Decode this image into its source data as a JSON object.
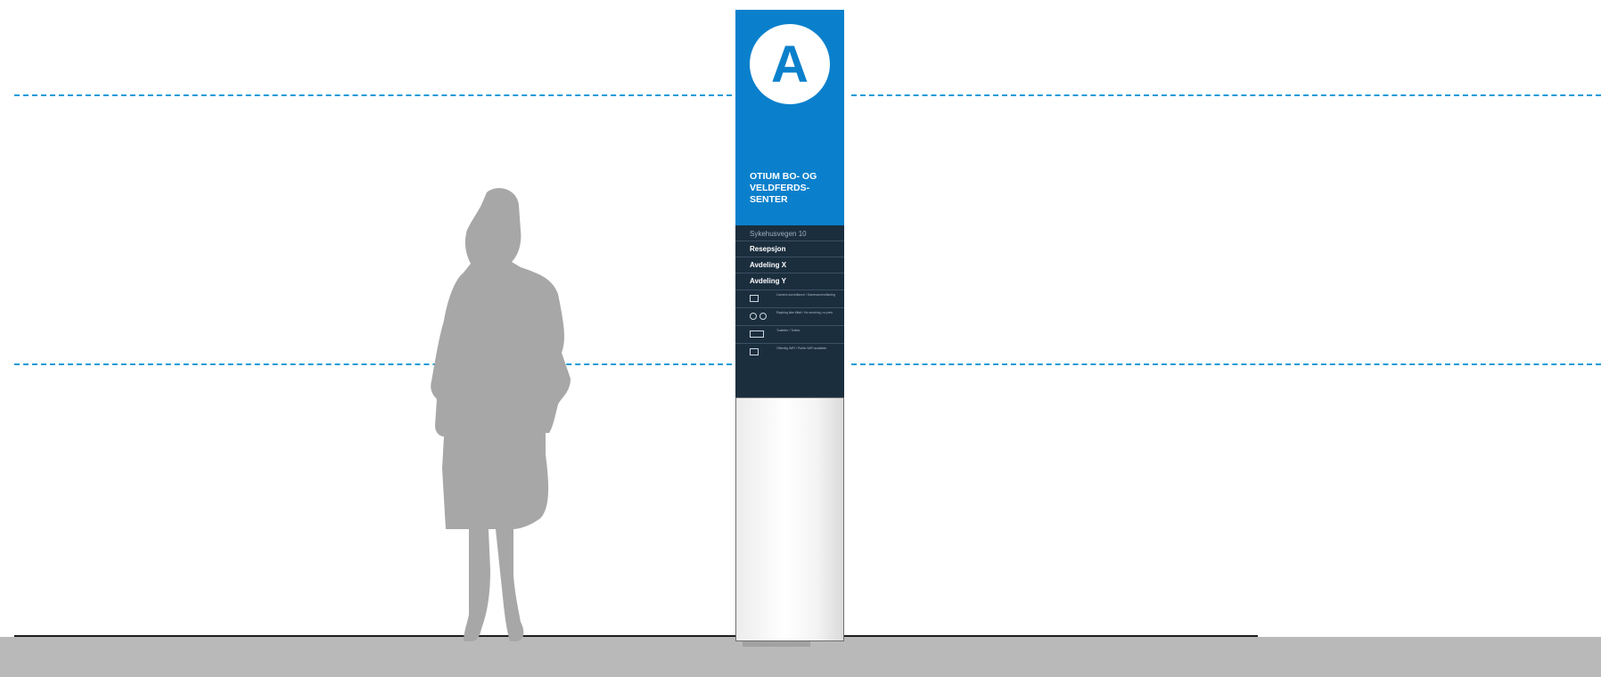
{
  "sign": {
    "letter": "A",
    "title": "OTIUM BO- OG VELDFERDS- SENTER",
    "address": "Sykehusvegen 10",
    "destinations": [
      "Resepsjon",
      "Avdeling X",
      "Avdeling Y"
    ],
    "info_rows": [
      {
        "icon": "camera-icon",
        "text": "Camera surveillance / Kameraovervåkning"
      },
      {
        "icon": "no-smoking-icon",
        "text": "Røyking ikke tillatt / No smoking, no pets"
      },
      {
        "icon": "toilet-icon",
        "text": "Toaletter / Toilets"
      },
      {
        "icon": "wifi-icon",
        "text": "Offentlig WiFi / Public WiFi available"
      }
    ]
  },
  "colors": {
    "brand_blue": "#0a80cc",
    "panel_navy": "#1b2e3e",
    "guide_line": "#1a9bd7",
    "silhouette": "#a7a7a7",
    "ground": "#b9b9b9"
  }
}
